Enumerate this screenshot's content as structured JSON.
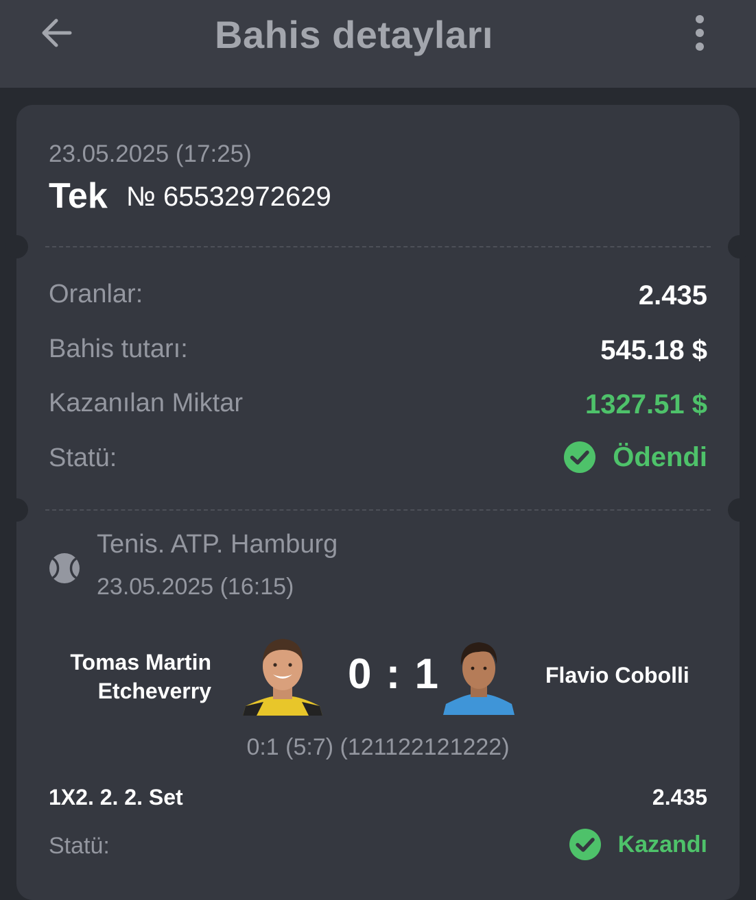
{
  "header": {
    "title": "Bahis detayları",
    "back_icon": "arrow-left-icon",
    "menu_icon": "more-vertical-icon"
  },
  "bet": {
    "datetime": "23.05.2025 (17:25)",
    "type": "Tek",
    "number": "№ 65532972629",
    "rows": {
      "odds_label": "Oranlar:",
      "odds_value": "2.435",
      "stake_label": "Bahis tutarı:",
      "stake_value": "545.18 $",
      "win_label": "Kazanılan Miktar",
      "win_value": "1327.51 $",
      "status_label": "Statü:",
      "status_value": "Ödendi"
    }
  },
  "event": {
    "sport_icon": "tennis-ball-icon",
    "league": "Tenis. ATP. Hamburg",
    "datetime": "23.05.2025 (16:15)",
    "player1": "Tomas Martin Etcheverry",
    "player2": "Flavio Cobolli",
    "score": "0 : 1",
    "sets": "0:1 (5:7) (121122121222)",
    "market": "1X2. 2. 2. Set",
    "market_odds": "2.435",
    "status_label": "Statü:",
    "status_value": "Kazandı"
  },
  "colors": {
    "background": "#272a30",
    "topbar": "#3a3d45",
    "card": "#353840",
    "accent_green": "#4ec26a",
    "muted_text": "#9497a0"
  }
}
